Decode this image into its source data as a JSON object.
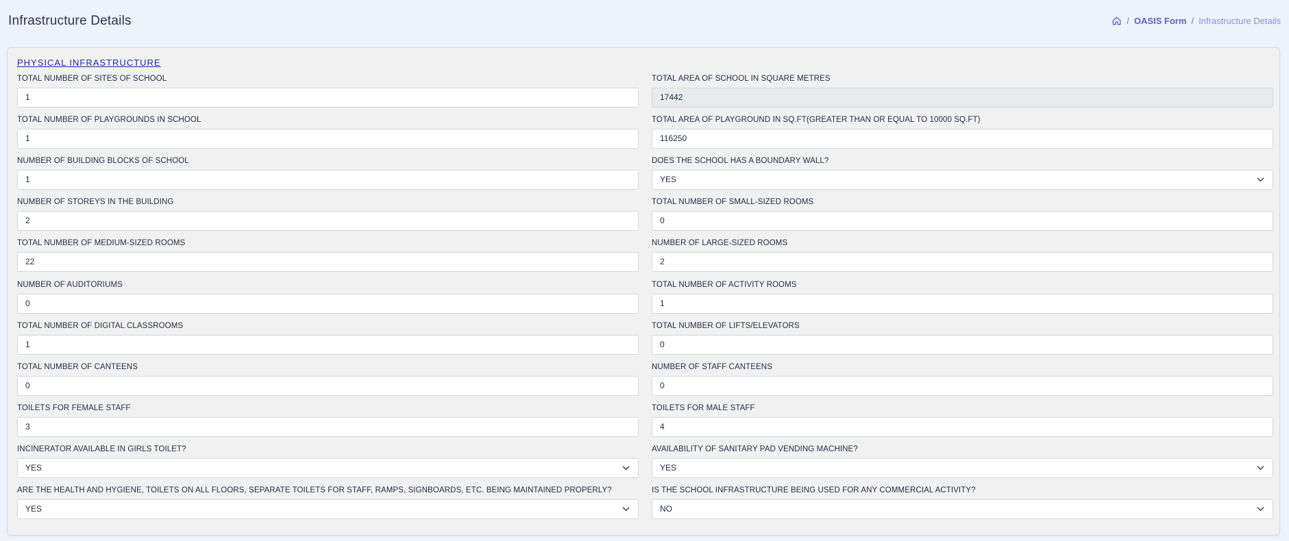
{
  "header": {
    "title": "Infrastructure Details",
    "breadcrumb": {
      "home_icon": "home-icon",
      "separator": "/",
      "link": "OASIS Form",
      "current": "Infrastructure Details"
    }
  },
  "section": {
    "title": "PHYSICAL INFRASTRUCTURE"
  },
  "fields": [
    {
      "label": "TOTAL NUMBER OF SITES OF SCHOOL",
      "value": "1",
      "type": "text"
    },
    {
      "label": "TOTAL AREA OF SCHOOL IN SQUARE METRES",
      "value": "17442",
      "type": "readonly"
    },
    {
      "label": "TOTAL NUMBER OF PLAYGROUNDS IN SCHOOL",
      "value": "1",
      "type": "text"
    },
    {
      "label": "TOTAL AREA OF PLAYGROUND IN SQ.FT(GREATER THAN OR EQUAL TO 10000 SQ.FT)",
      "value": "116250",
      "type": "text"
    },
    {
      "label": "NUMBER OF BUILDING BLOCKS OF SCHOOL",
      "value": "1",
      "type": "text"
    },
    {
      "label": "DOES THE SCHOOL HAS A BOUNDARY WALL?",
      "value": "YES",
      "type": "select"
    },
    {
      "label": "NUMBER OF STOREYS IN THE BUILDING",
      "value": "2",
      "type": "text"
    },
    {
      "label": "TOTAL NUMBER OF SMALL-SIZED ROOMS",
      "value": "0",
      "type": "text"
    },
    {
      "label": "TOTAL NUMBER OF MEDIUM-SIZED ROOMS",
      "value": "22",
      "type": "text"
    },
    {
      "label": "NUMBER OF LARGE-SIZED ROOMS",
      "value": "2",
      "type": "text"
    },
    {
      "label": "NUMBER OF AUDITORIUMS",
      "value": "0",
      "type": "text"
    },
    {
      "label": "TOTAL NUMBER OF ACTIVITY ROOMS",
      "value": "1",
      "type": "text"
    },
    {
      "label": "TOTAL NUMBER OF DIGITAL CLASSROOMS",
      "value": "1",
      "type": "text"
    },
    {
      "label": "TOTAL NUMBER OF LIFTS/ELEVATORS",
      "value": "0",
      "type": "text"
    },
    {
      "label": "TOTAL NUMBER OF CANTEENS",
      "value": "0",
      "type": "text"
    },
    {
      "label": "NUMBER OF STAFF CANTEENS",
      "value": "0",
      "type": "text"
    },
    {
      "label": "TOILETS FOR FEMALE STAFF",
      "value": "3",
      "type": "text"
    },
    {
      "label": "TOILETS FOR MALE STAFF",
      "value": "4",
      "type": "text"
    },
    {
      "label": "INCINERATOR AVAILABLE IN GIRLS TOILET?",
      "value": "YES",
      "type": "select"
    },
    {
      "label": "AVAILABILITY OF SANITARY PAD VENDING MACHINE?",
      "value": "YES",
      "type": "select"
    },
    {
      "label": "ARE THE HEALTH AND HYGIENE, TOILETS ON ALL FLOORS, SEPARATE TOILETS FOR STAFF, RAMPS, SIGNBOARDS, ETC. BEING MAINTAINED PROPERLY?",
      "value": "YES",
      "type": "select"
    },
    {
      "label": "IS THE SCHOOL INFRASTRUCTURE BEING USED FOR ANY COMMERCIAL ACTIVITY?",
      "value": "NO",
      "type": "select"
    }
  ],
  "colors": {
    "page_bg": "#eef2fa",
    "card_bg": "#f1f1f1",
    "section_title": "#1a2ba8",
    "breadcrumb_link": "#5b5fd0",
    "readonly_bg": "#e9eaed"
  }
}
